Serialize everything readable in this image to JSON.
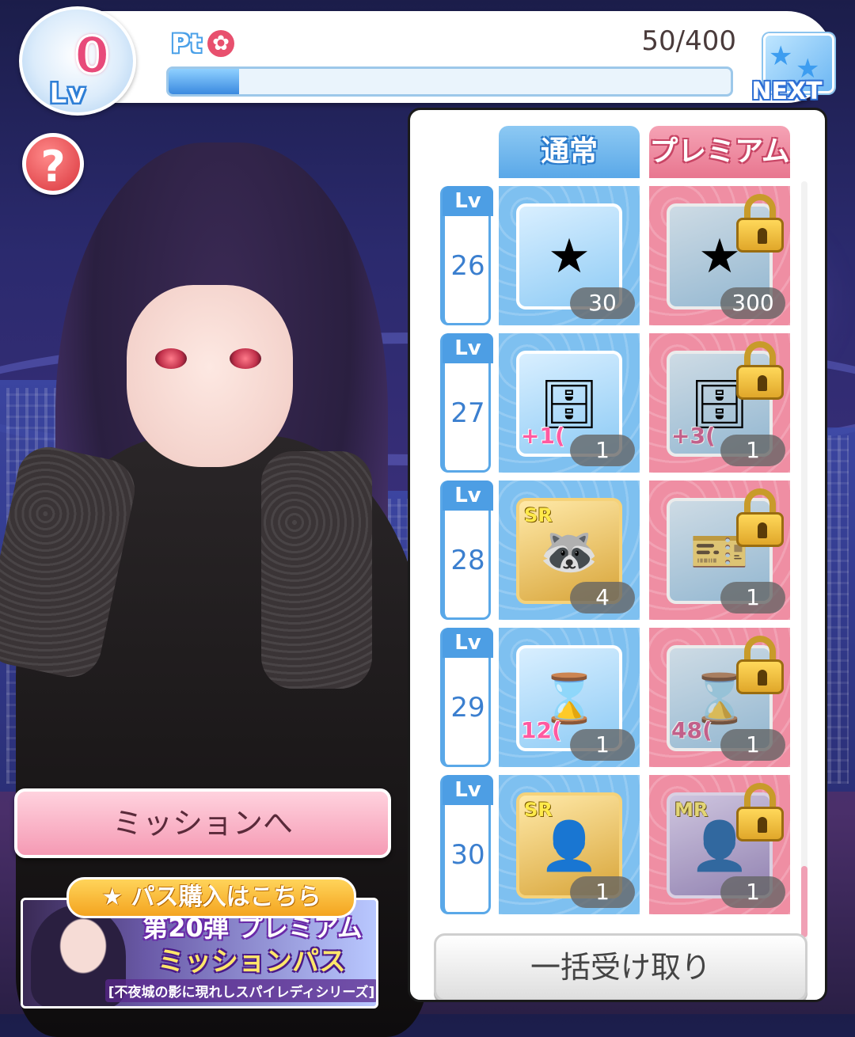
{
  "level": {
    "tag": "Lv",
    "value": "0"
  },
  "points": {
    "label": "Pt",
    "icon": "sakura-icon",
    "count": "50/400",
    "progress": 0.125
  },
  "next": {
    "label": "NEXT"
  },
  "help": {
    "symbol": "?"
  },
  "columns": {
    "normal": "通常",
    "premium": "プレミアム"
  },
  "rows": [
    {
      "lv_tag": "Lv",
      "lv": "26",
      "normal": {
        "icon": "star-icon",
        "glyph": "★",
        "qty": "30",
        "rarity": "",
        "bonus": ""
      },
      "premium": {
        "icon": "star-icon",
        "glyph": "★",
        "qty": "300",
        "rarity": "",
        "bonus": "",
        "locked": true
      }
    },
    {
      "lv_tag": "Lv",
      "lv": "27",
      "normal": {
        "icon": "dresser-icon",
        "glyph": "🗄",
        "qty": "1",
        "rarity": "",
        "bonus": "+1("
      },
      "premium": {
        "icon": "dresser-icon",
        "glyph": "🗄",
        "qty": "1",
        "rarity": "",
        "bonus": "+3(",
        "locked": true
      }
    },
    {
      "lv_tag": "Lv",
      "lv": "28",
      "normal": {
        "icon": "raccoon-card-icon",
        "glyph": "🦝",
        "qty": "4",
        "rarity": "SR",
        "bonus": ""
      },
      "premium": {
        "icon": "ticket-icon",
        "glyph": "🎫",
        "qty": "1",
        "rarity": "",
        "bonus": "",
        "locked": true
      }
    },
    {
      "lv_tag": "Lv",
      "lv": "29",
      "normal": {
        "icon": "hourglass-icon",
        "glyph": "⌛",
        "qty": "1",
        "rarity": "",
        "bonus": "12("
      },
      "premium": {
        "icon": "hourglass-icon",
        "glyph": "⌛",
        "qty": "1",
        "rarity": "",
        "bonus": "48(",
        "locked": true
      }
    },
    {
      "lv_tag": "Lv",
      "lv": "30",
      "normal": {
        "icon": "character-card-icon",
        "glyph": "👤",
        "qty": "1",
        "rarity": "SR",
        "bonus": ""
      },
      "premium": {
        "icon": "character-card-icon",
        "glyph": "👤",
        "qty": "1",
        "rarity": "MR",
        "bonus": "",
        "locked": true
      }
    }
  ],
  "buttons": {
    "receive_all": "一括受け取り",
    "mission": "ミッションへ"
  },
  "pass": {
    "tag": "パス購入はこちら",
    "title1": "第20弾 プレミアム",
    "title2": "ミッションパス",
    "series": "[不夜城の影に現れしスパイレディシリーズ]"
  },
  "scroll": {
    "position": 0.92
  }
}
